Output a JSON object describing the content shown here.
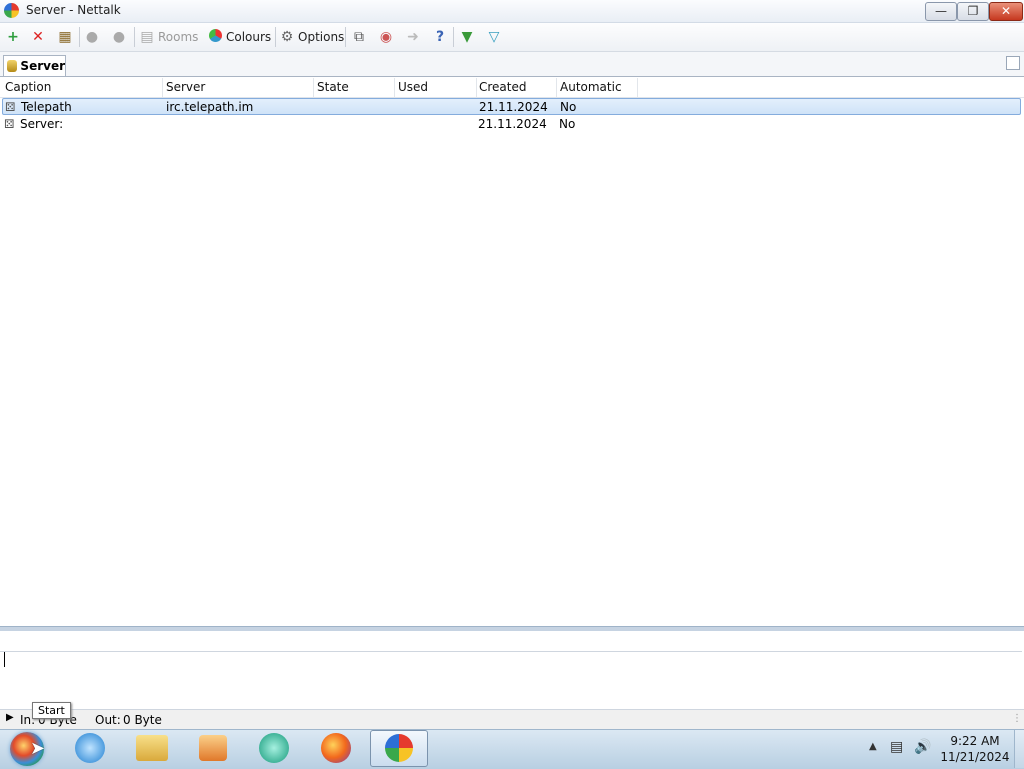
{
  "window": {
    "title": "Server  -  Nettalk"
  },
  "toolbar": {
    "rooms_label": "Rooms",
    "colours_label": "Colours",
    "options_label": "Options"
  },
  "tabs": [
    {
      "label": "Server"
    }
  ],
  "list": {
    "columns": [
      "Caption",
      "Server",
      "State",
      "Used",
      "Created",
      "Automatic"
    ],
    "rows": [
      {
        "caption": "Telepath",
        "server": "irc.telepath.im",
        "state": "",
        "used": "",
        "created": "21.11.2024",
        "automatic": "No",
        "selected": true
      },
      {
        "caption": "Server:",
        "server": "",
        "state": "",
        "used": "",
        "created": "21.11.2024",
        "automatic": "No",
        "selected": false
      }
    ]
  },
  "statusbar": {
    "in_label": "In:",
    "in_value": "0 Byte",
    "out_label": "Out:",
    "out_value": "0 Byte"
  },
  "tooltip": "Start",
  "clock": {
    "time": "9:22 AM",
    "date": "11/21/2024"
  }
}
